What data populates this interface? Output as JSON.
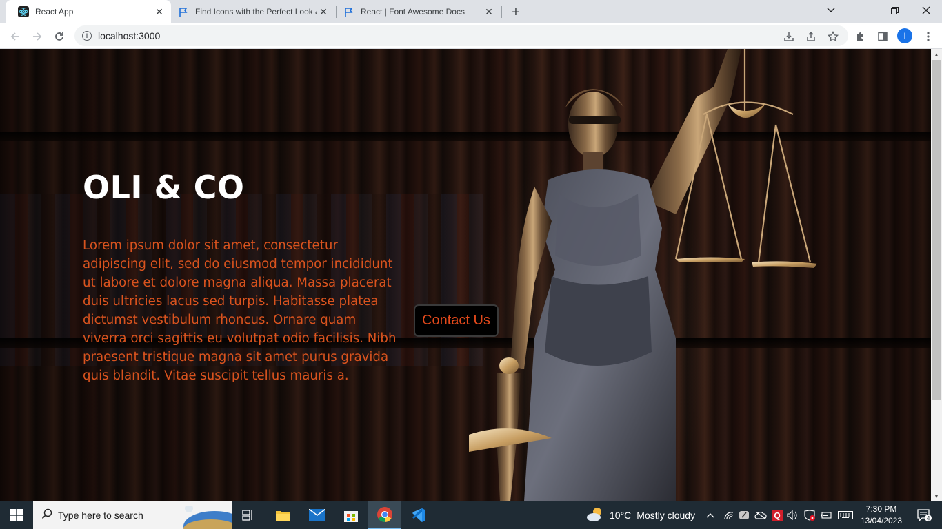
{
  "browser": {
    "tabs": [
      {
        "title": "React App",
        "active": true
      },
      {
        "title": "Find Icons with the Perfect Look &",
        "active": false
      },
      {
        "title": "React | Font Awesome Docs",
        "active": false
      }
    ],
    "url": "localhost:3000",
    "profile_initial": "I"
  },
  "page": {
    "title": "OLI & CO",
    "body": "Lorem ipsum dolor sit amet, consectetur adipiscing elit, sed do eiusmod tempor incididunt ut labore et dolore magna aliqua. Massa placerat duis ultricies lacus sed turpis. Habitasse platea dictumst vestibulum rhoncus. Ornare quam viverra orci sagittis eu volutpat odio facilisis. Nibh praesent tristique magna sit amet purus gravida quis blandit. Vitae suscipit tellus mauris a.",
    "contact_button": "Contact Us",
    "colors": {
      "accent": "#d9531e",
      "title": "#ffffff",
      "button_bg": "#000000"
    }
  },
  "taskbar": {
    "search_placeholder": "Type here to search",
    "weather_temp": "10°C",
    "weather_desc": "Mostly cloudy",
    "time": "7:30 PM",
    "date": "13/04/2023",
    "notification_count": "4"
  }
}
